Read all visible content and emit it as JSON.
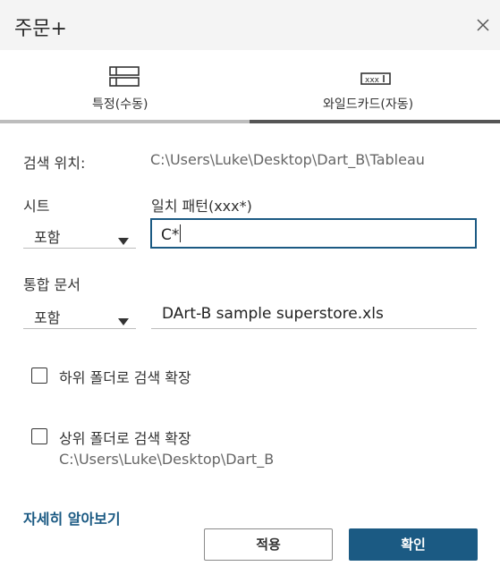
{
  "dialog": {
    "title": "주문+",
    "close_icon": "close-icon"
  },
  "tabs": [
    {
      "label": "특정(수동)",
      "icon": "list-icon",
      "active": false
    },
    {
      "label": "와일드카드(자동)",
      "icon": "wildcard-icon",
      "active": true
    }
  ],
  "tab_colors": {
    "inactive_underline": "#bdbdbd",
    "active_underline": "#555555"
  },
  "search_location": {
    "label": "검색 위치:",
    "path": "C:\\Users\\Luke\\Desktop\\Dart_B\\Tableau"
  },
  "sheets": {
    "label": "시트",
    "select_value": "포함",
    "pattern_label": "일치 패턴(xxx*)",
    "pattern_value": "C*"
  },
  "union_files": {
    "label": "통합 문서",
    "select_value": "포함",
    "pattern_value": "DArt-B sample superstore.xls"
  },
  "options": {
    "subfolders_label": "하위 폴더로 검색 확장",
    "subfolders_checked": false,
    "parent_label": "상위 폴더로 검색 확장",
    "parent_checked": false,
    "parent_path": "C:\\Users\\Luke\\Desktop\\Dart_B"
  },
  "footer": {
    "learn_more": "자세히 알아보기",
    "apply_label": "적용",
    "ok_label": "확인"
  },
  "colors": {
    "accent": "#1b5a83",
    "titlebar_bg": "#f4f4f4"
  }
}
